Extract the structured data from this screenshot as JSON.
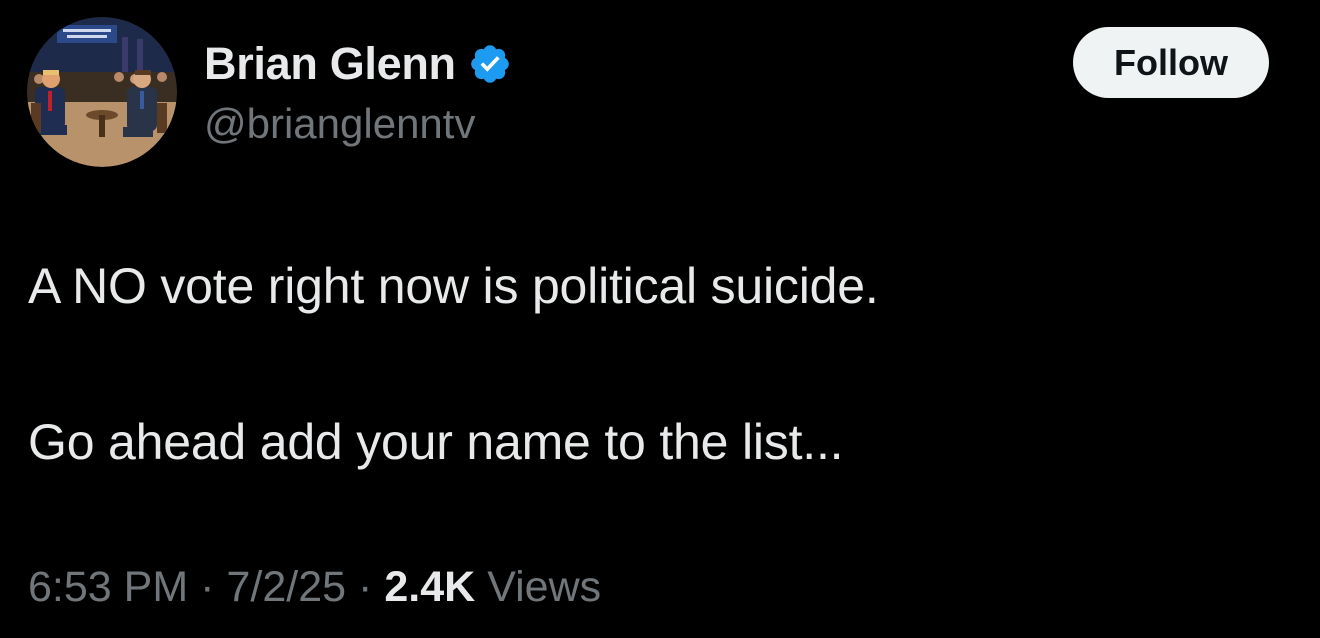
{
  "author": {
    "display_name": "Brian Glenn",
    "handle": "@brianglenntv",
    "verified_color": "#1d9bf0"
  },
  "follow_button": {
    "label": "Follow"
  },
  "tweet": {
    "lines": [
      "A NO vote right now is political suicide.",
      "Go ahead add your name to the list..."
    ]
  },
  "meta": {
    "time": "6:53 PM",
    "date": "7/2/25",
    "separator": "·",
    "views_count": "2.4K",
    "views_label": "Views"
  },
  "colors": {
    "background": "#000000",
    "primary_text": "#e7e9ea",
    "secondary_text": "#71767b",
    "button_bg": "#eff3f4",
    "button_text": "#0f1419"
  }
}
